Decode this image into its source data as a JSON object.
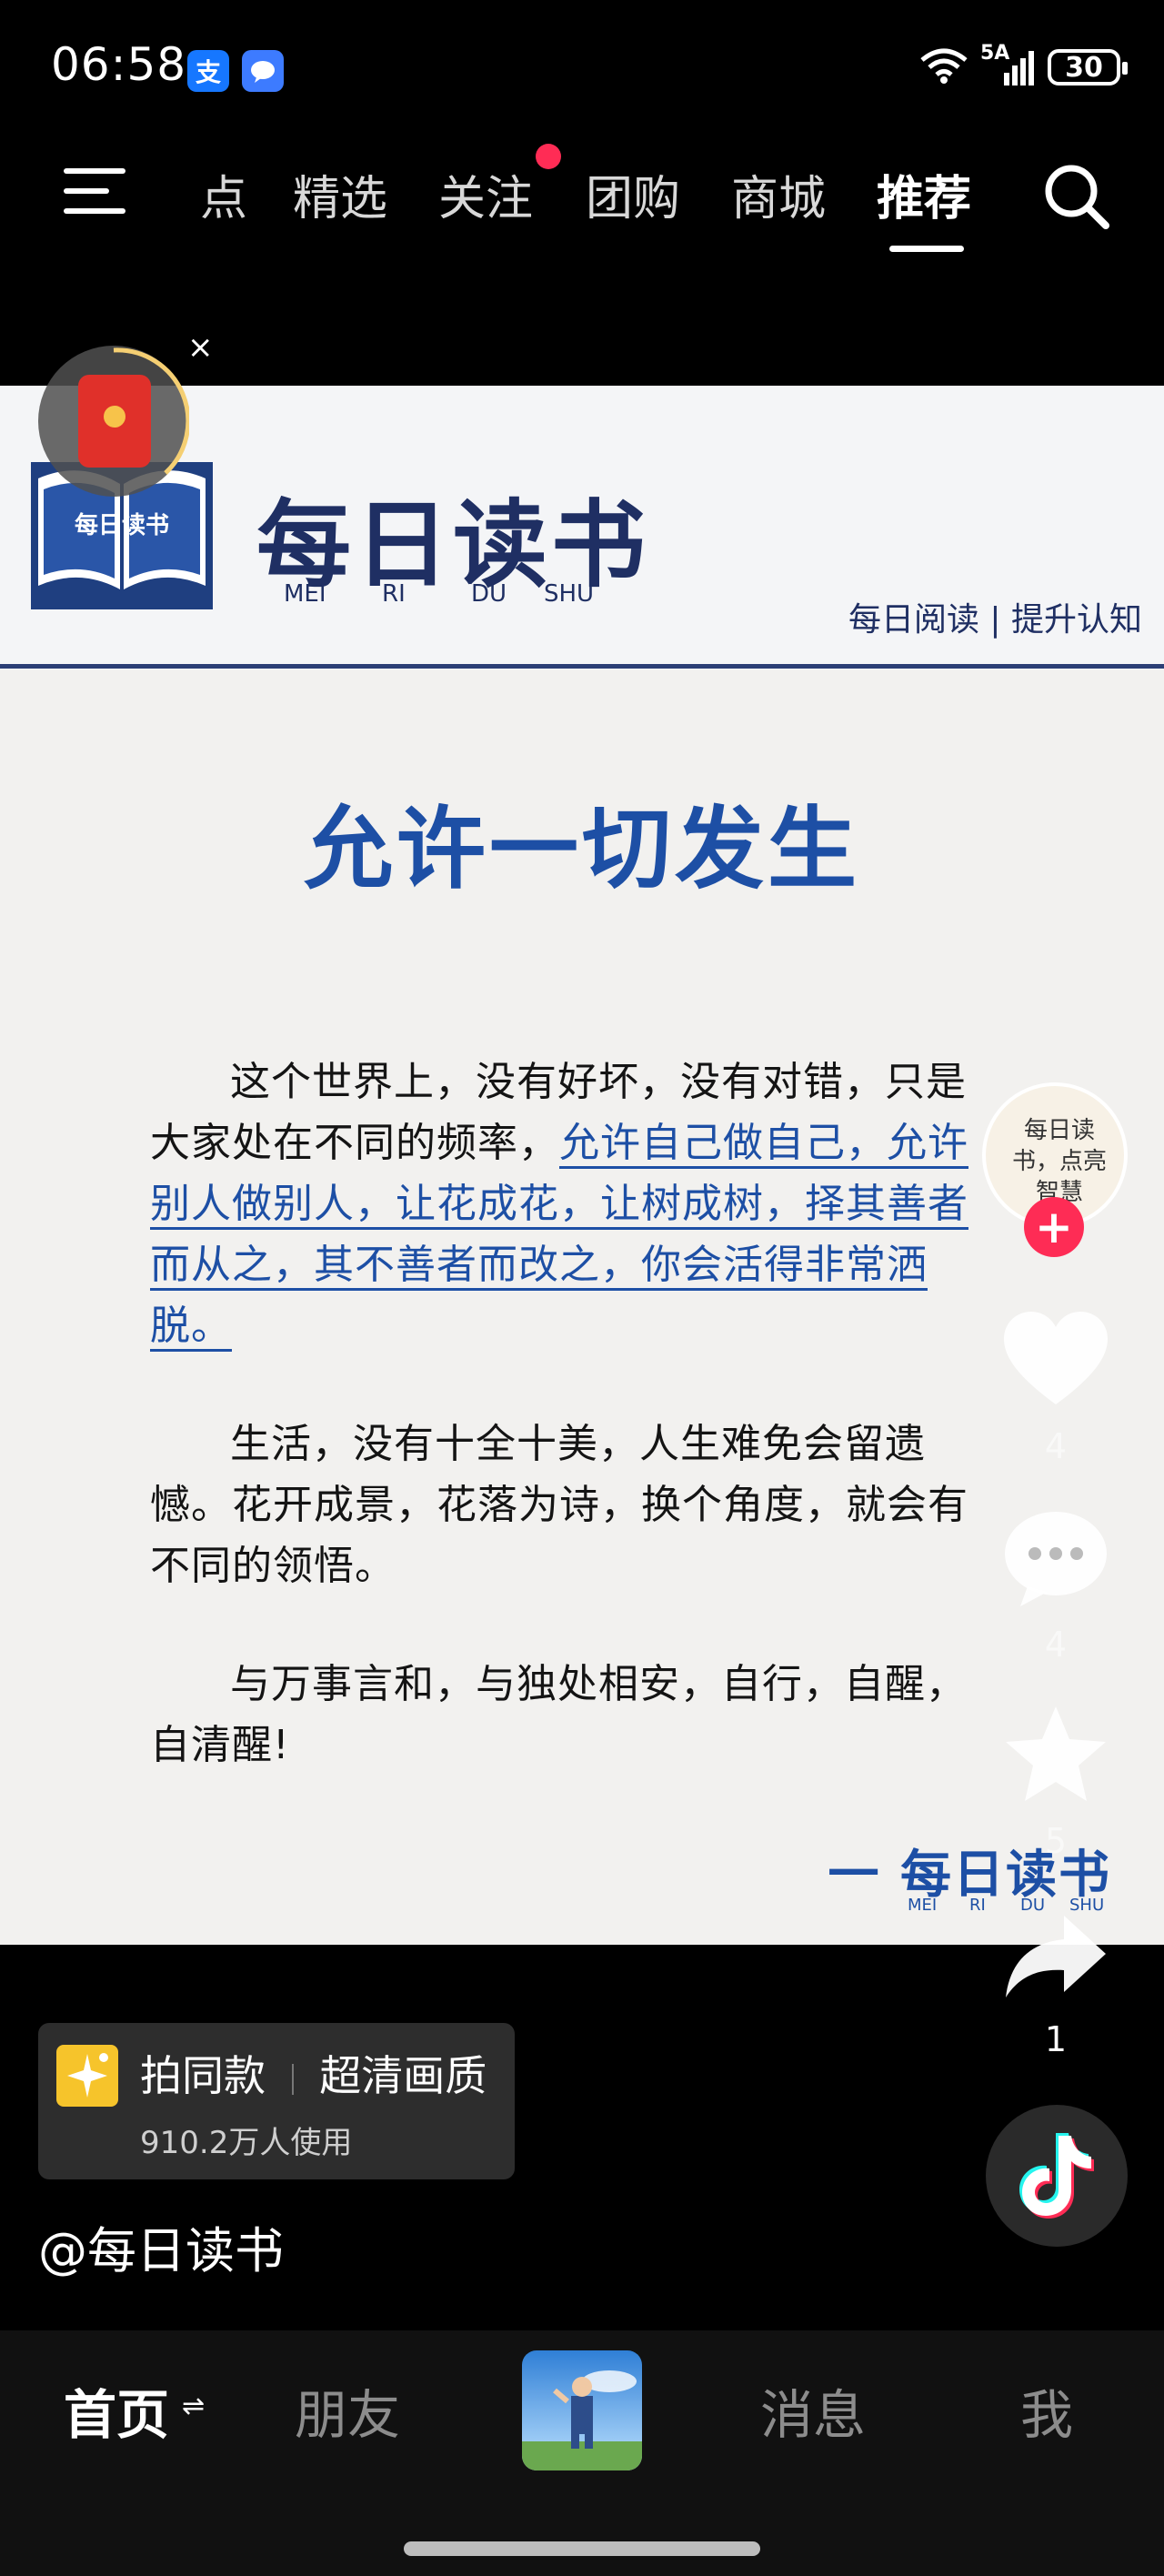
{
  "status_bar": {
    "time": "06:58",
    "alipay_glyph": "支",
    "network": "5A",
    "battery": "30",
    "icons": [
      "alipay-icon",
      "message-app-icon",
      "wifi-icon",
      "signal-icon",
      "battery-icon"
    ]
  },
  "top_nav": {
    "tabs": [
      {
        "label": "点"
      },
      {
        "label": "精选"
      },
      {
        "label": "关注",
        "badge": true
      },
      {
        "label": "团购"
      },
      {
        "label": "商城"
      },
      {
        "label": "推荐",
        "active": true
      }
    ],
    "icons": [
      "menu-icon",
      "search-icon"
    ]
  },
  "post_image": {
    "brand": {
      "logo_text": "每日读书",
      "title": "每日读书",
      "pinyin": [
        "MEI",
        "RI",
        "DU",
        "SHU"
      ],
      "tagline": "每日阅读 | 提升认知"
    },
    "title": "允许一切发生",
    "paragraph1_pre": "这个世界上，没有好坏，没有对错，只是大家处在不同的频率，",
    "paragraph1_highlight": "允许自己做自己，允许别人做别人，让花成花，让树成树，择其善者而从之，其不善者而改之，你会活得非常洒脱。",
    "paragraph2": "生活，没有十全十美，人生难免会留遗憾。花开成景，花落为诗，换个角度，就会有不同的领悟。",
    "paragraph3": "与万事言和，与独处相安，自行，自醒，自清醒!",
    "signature": "一 每日读书",
    "signature_pinyin": [
      "MEI",
      "RI",
      "DU",
      "SHU"
    ]
  },
  "floating": {
    "close": "×",
    "icon": "red-packet-icon"
  },
  "right_rail": {
    "avatar_text": "每日读书，点亮智慧",
    "follow": "+",
    "likes": "4",
    "comments": "4",
    "favorites": "5",
    "shares": "1"
  },
  "template": {
    "action": "拍同款",
    "quality": "超清画质",
    "users": "910.2万人使用"
  },
  "author": "@每日读书",
  "bottom_nav": {
    "home": "首页",
    "home_swap": "⇌",
    "friends": "朋友",
    "messages": "消息",
    "me": "我"
  },
  "colors": {
    "accent_blue": "#1d4fa5",
    "brand_navy": "#1f2f63",
    "like_red": "#fe2c55",
    "background": "#000000"
  }
}
